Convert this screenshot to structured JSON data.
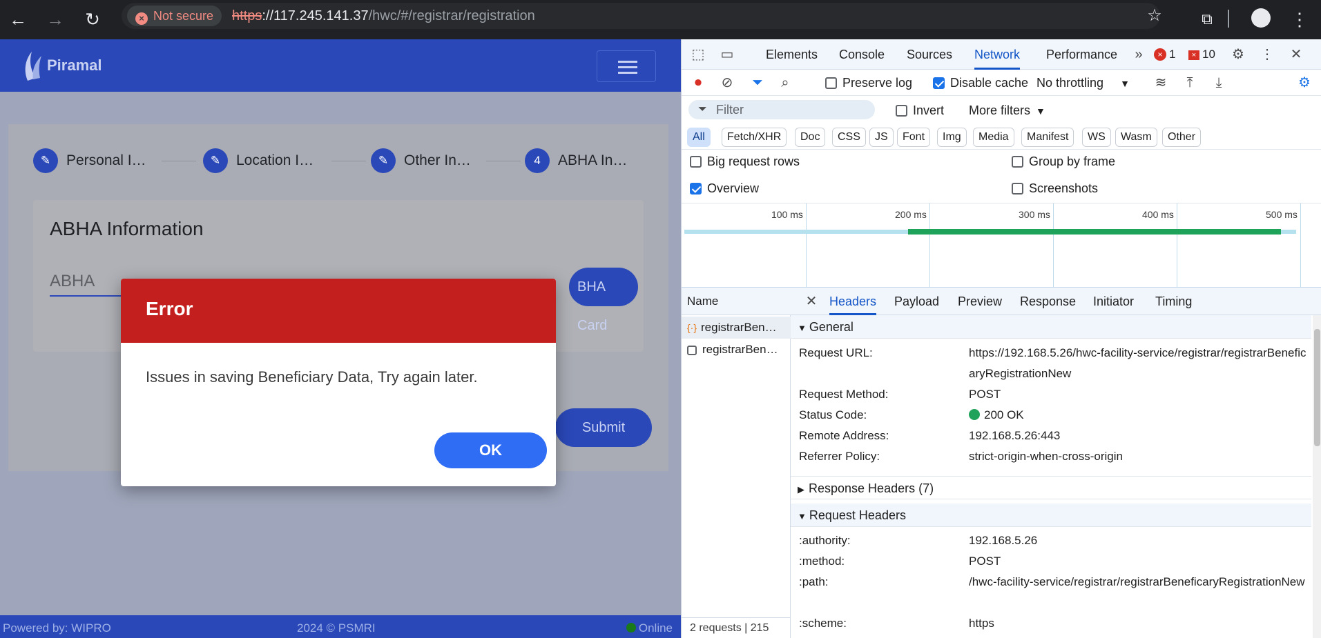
{
  "browser": {
    "not_secure": "Not secure",
    "url_proto": "https",
    "url_host": "://117.245.141.37",
    "url_path": "/hwc/#/registrar/registration"
  },
  "app": {
    "logo": "Piramal",
    "steps": [
      {
        "label": "Personal I…",
        "icon": "pencil-icon"
      },
      {
        "label": "Location I…",
        "icon": "pencil-icon"
      },
      {
        "label": "Other In…",
        "icon": "pencil-icon"
      },
      {
        "label": "ABHA In…",
        "number": "4"
      }
    ],
    "abha_title": "ABHA Information",
    "abha_placeholder": "ABHA",
    "abha_card_btn": "BHA Card",
    "submit_btn": "Submit",
    "footer": {
      "left": "Powered by: WIPRO",
      "middle": "2024 © PSMRI",
      "right": "Online"
    }
  },
  "modal": {
    "title": "Error",
    "message": "Issues in saving Beneficiary Data, Try again later.",
    "ok": "OK"
  },
  "devtools": {
    "tabs": [
      "Elements",
      "Console",
      "Sources",
      "Network",
      "Performance"
    ],
    "active_tab": "Network",
    "error_count": "1",
    "warn_count": "10",
    "toolbar": {
      "preserve_log": "Preserve log",
      "disable_cache": "Disable cache",
      "throttling": "No throttling"
    },
    "filter": {
      "placeholder": "Filter",
      "invert": "Invert",
      "more_filters": "More filters"
    },
    "types": [
      "All",
      "Fetch/XHR",
      "Doc",
      "CSS",
      "JS",
      "Font",
      "Img",
      "Media",
      "Manifest",
      "WS",
      "Wasm",
      "Other"
    ],
    "options": {
      "big_rows": "Big request rows",
      "group_by_frame": "Group by frame",
      "overview": "Overview",
      "screenshots": "Screenshots"
    },
    "timeline_ticks": [
      "100 ms",
      "200 ms",
      "300 ms",
      "400 ms",
      "500 ms"
    ],
    "name_header": "Name",
    "requests": [
      "registrarBen…",
      "registrarBen…"
    ],
    "status_bar": "2 requests  |  215",
    "detail_tabs": [
      "Headers",
      "Payload",
      "Preview",
      "Response",
      "Initiator",
      "Timing"
    ],
    "general": {
      "title": "General",
      "request_url_key": "Request URL:",
      "request_url": "https://192.168.5.26/hwc-facility-service/registrar/registrarBeneficaryRegistrationNew",
      "method_key": "Request Method:",
      "method": "POST",
      "status_key": "Status Code:",
      "status": "200 OK",
      "remote_key": "Remote Address:",
      "remote": "192.168.5.26:443",
      "referrer_key": "Referrer Policy:",
      "referrer": "strict-origin-when-cross-origin"
    },
    "response_headers": "Response Headers (7)",
    "request_headers": {
      "title": "Request Headers",
      "authority_key": ":authority:",
      "authority": "192.168.5.26",
      "method_key": ":method:",
      "method": "POST",
      "path_key": ":path:",
      "path": "/hwc-facility-service/registrar/registrarBeneficaryRegistrationNew",
      "scheme_key": ":scheme:",
      "scheme": "https"
    }
  }
}
